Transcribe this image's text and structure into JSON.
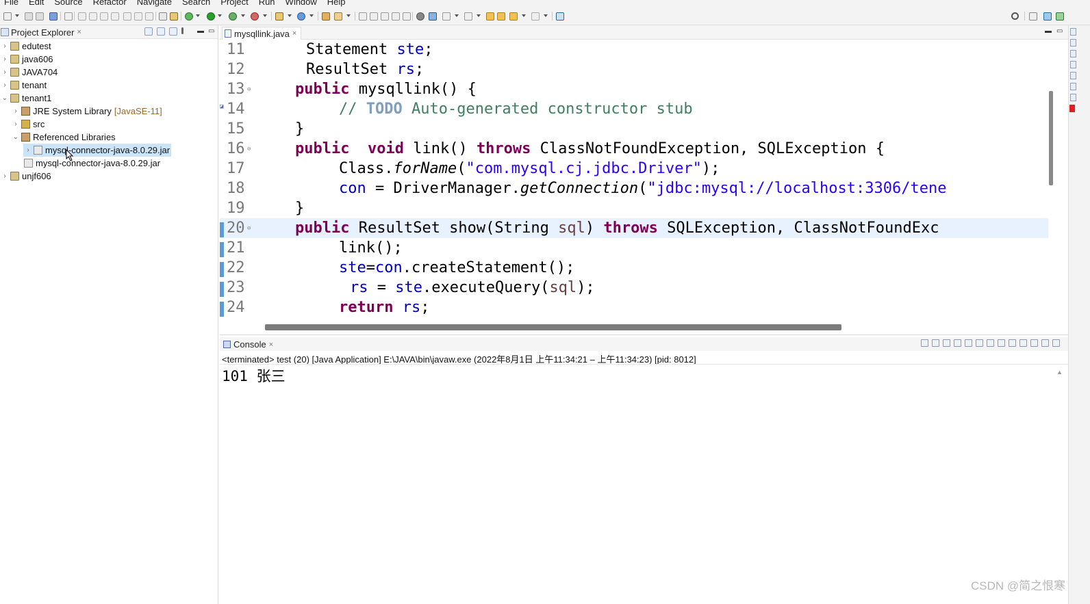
{
  "menu": [
    "File",
    "Edit",
    "Source",
    "Refactor",
    "Navigate",
    "Search",
    "Project",
    "Run",
    "Window",
    "Help"
  ],
  "project_explorer": {
    "title": "Project Explorer",
    "close": "×",
    "items": [
      {
        "label": "edutest",
        "arrow": "›",
        "icon": "project-icon",
        "decoration": ""
      },
      {
        "label": "java606",
        "arrow": "›",
        "icon": "project-icon",
        "decoration": ""
      },
      {
        "label": "JAVA704",
        "arrow": "›",
        "icon": "project-icon",
        "decoration": ""
      },
      {
        "label": "tenant",
        "arrow": "›",
        "icon": "project-icon",
        "decoration": ""
      },
      {
        "label": "tenant1",
        "arrow": "⌄",
        "icon": "project-icon",
        "decoration": ""
      },
      {
        "label": "JRE System Library",
        "arrow": "›",
        "icon": "library-icon",
        "decoration": "[JavaSE-11]"
      },
      {
        "label": "src",
        "arrow": "›",
        "icon": "package-folder-icon",
        "decoration": ""
      },
      {
        "label": "Referenced Libraries",
        "arrow": "⌄",
        "icon": "library-icon",
        "decoration": ""
      },
      {
        "label": "mysql-connector-java-8.0.29.jar",
        "arrow": "›",
        "icon": "jar-icon",
        "decoration": ""
      },
      {
        "label": "mysql-connector-java-8.0.29.jar",
        "arrow": "",
        "icon": "jar-icon",
        "decoration": ""
      },
      {
        "label": "unjf606",
        "arrow": "›",
        "icon": "project-icon",
        "decoration": ""
      }
    ]
  },
  "editor": {
    "tab_label": "mysqllink.java",
    "tab_close": "×",
    "line_numbers": [
      "11",
      "12",
      "13",
      "14",
      "15",
      "16",
      "17",
      "18",
      "19",
      "20",
      "21",
      "22",
      "23",
      "24"
    ],
    "code": {
      "l11_type": "Statement ",
      "l11_var": "ste",
      "l11_end": ";",
      "l12_type": "ResultSet ",
      "l12_var": "rs",
      "l12_end": ";",
      "l13_kw": "public",
      "l13_rest": " mysqllink() {",
      "l14_cm1": "// ",
      "l14_todo": "TODO",
      "l14_cm2": " Auto-generated constructor stub",
      "l15": "}",
      "l16_kw1": "public",
      "l16_kw2": "void",
      "l16_mid": " link() ",
      "l16_kw3": "throws",
      "l16_rest": " ClassNotFoundException, SQLException {",
      "l17_a": "Class.",
      "l17_m": "forName",
      "l17_b": "(",
      "l17_s": "\"com.mysql.cj.jdbc.Driver\"",
      "l17_c": ");",
      "l18_f": "con",
      "l18_a": " = DriverManager.",
      "l18_m": "getConnection",
      "l18_b": "(",
      "l18_s": "\"jdbc:mysql://localhost:3306/tene",
      "l19": "}",
      "l20_kw1": "public",
      "l20_a": " ResultSet show(String ",
      "l20_v": "sql",
      "l20_b": ") ",
      "l20_kw2": "throws",
      "l20_rest": " SQLException, ClassNotFoundExc",
      "l21": "link();",
      "l22_f1": "ste",
      "l22_a": "=",
      "l22_f2": "con",
      "l22_b": ".createStatement();",
      "l23_f1": "rs",
      "l23_a": " = ",
      "l23_f2": "ste",
      "l23_b": ".executeQuery(",
      "l23_v": "sql",
      "l23_c": ");",
      "l24_kw": "return",
      "l24_sp": " ",
      "l24_f": "rs",
      "l24_end": ";"
    }
  },
  "console": {
    "title": "Console",
    "close": "×",
    "status": "<terminated> test (20) [Java Application] E:\\JAVA\\bin\\javaw.exe  (2022年8月1日 上午11:34:21 – 上午11:34:23) [pid: 8012]",
    "output": "101 张三"
  },
  "watermark": "CSDN @简之恨寒",
  "colors": {
    "keyword": "#7f0055",
    "field": "#0000c0",
    "comment": "#3f7f5f",
    "string": "#2a00ff",
    "selection": "#cce4f7"
  }
}
